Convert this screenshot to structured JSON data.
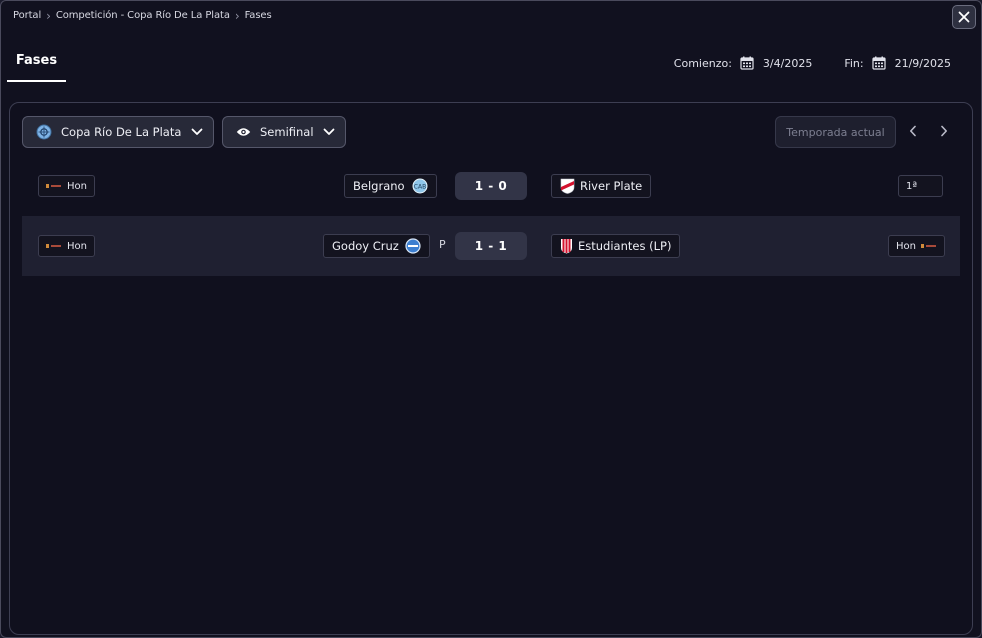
{
  "breadcrumb": [
    "Portal",
    "Competición - Copa Río De La Plata",
    "Fases"
  ],
  "header": {
    "tab": "Fases",
    "start_label": "Comienzo:",
    "start_date": "3/4/2025",
    "end_label": "Fin:",
    "end_date": "21/9/2025"
  },
  "filters": {
    "competition": "Copa Río De La Plata",
    "phase": "Semifinal",
    "season_placeholder": "Temporada actual"
  },
  "matches": [
    {
      "left_tag": "Hon",
      "home": "Belgrano",
      "score": "1 - 0",
      "penalties": "",
      "away": "River Plate",
      "right_tag": "1ª"
    },
    {
      "left_tag": "Hon",
      "home": "Godoy Cruz",
      "score": "1 - 1",
      "penalties": "P",
      "away": "Estudiantes (LP)",
      "right_tag": "Hon"
    }
  ],
  "colors": {
    "background": "#11111f",
    "panel_border": "#3d3e52",
    "control_bg": "#272938",
    "score_bg": "#323447",
    "alt_row": "#1f2031"
  },
  "icons": {
    "close": "close-icon",
    "calendar": "calendar-icon",
    "chevron": "chevron-down-icon",
    "eye": "eye-icon"
  }
}
